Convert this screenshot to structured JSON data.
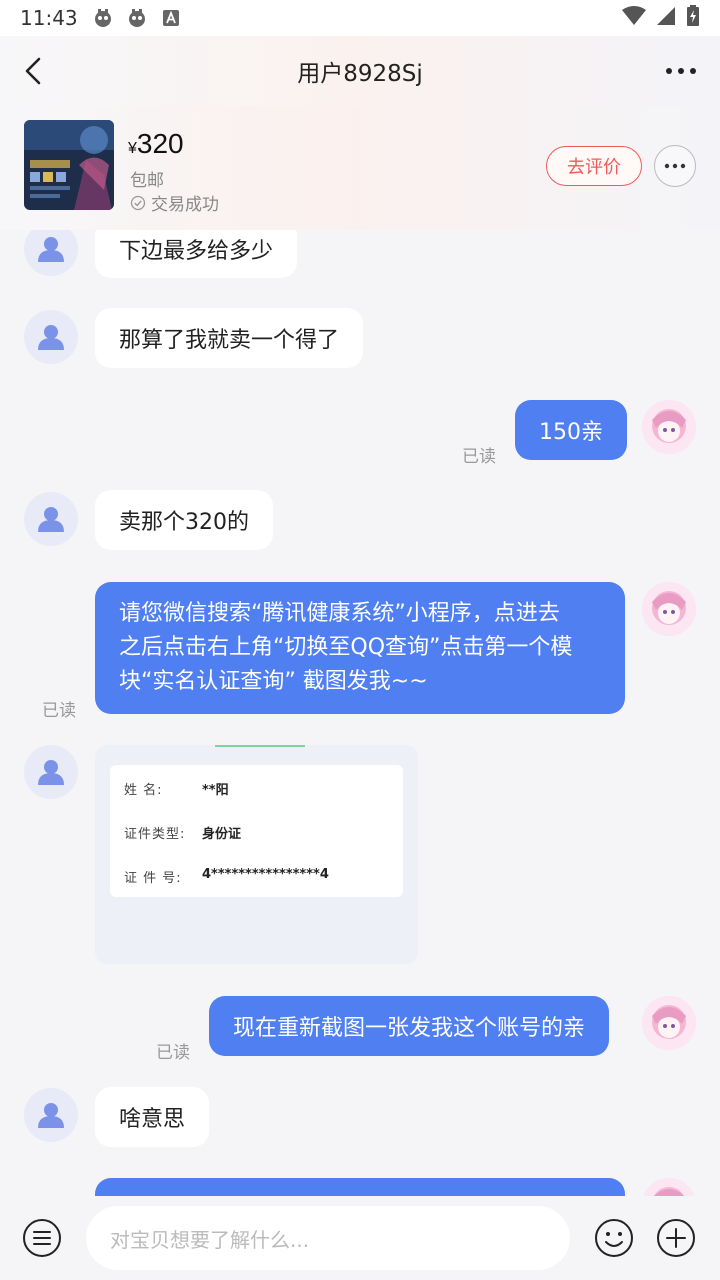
{
  "status_bar": {
    "time": "11:43"
  },
  "header": {
    "title": "用户8928Sj"
  },
  "product": {
    "currency": "¥",
    "price": "320",
    "shipping": "包邮",
    "status": "交易成功",
    "review_button": "去评价"
  },
  "messages": [
    {
      "side": "left",
      "text": "下边最多给多少"
    },
    {
      "side": "left",
      "text": "那算了我就卖一个得了"
    },
    {
      "side": "right",
      "text": "150亲",
      "read": "已读"
    },
    {
      "side": "left",
      "text": "卖那个320的"
    },
    {
      "side": "right",
      "lines": [
        "请您微信搜索“腾讯健康系统”小程序，点进去",
        "之后点击右上角“切换至QQ查询”点击第一个模",
        "块“实名认证查询” 截图发我~~"
      ],
      "read": "已读"
    },
    {
      "side": "left",
      "type": "image"
    },
    {
      "side": "right",
      "text": "现在重新截图一张发我这个账号的亲",
      "read": "已读"
    },
    {
      "side": "left",
      "text": "啥意思"
    }
  ],
  "id_card": {
    "rows": [
      {
        "label": "姓      名:",
        "value": "**阳"
      },
      {
        "label": "证件类型:",
        "value": "身份证"
      },
      {
        "label": "证  件  号:",
        "value": "4****************4"
      }
    ]
  },
  "input": {
    "placeholder": "对宝贝想要了解什么..."
  },
  "colors": {
    "accent": "#4f7ff0",
    "review": "#f05a5a"
  }
}
